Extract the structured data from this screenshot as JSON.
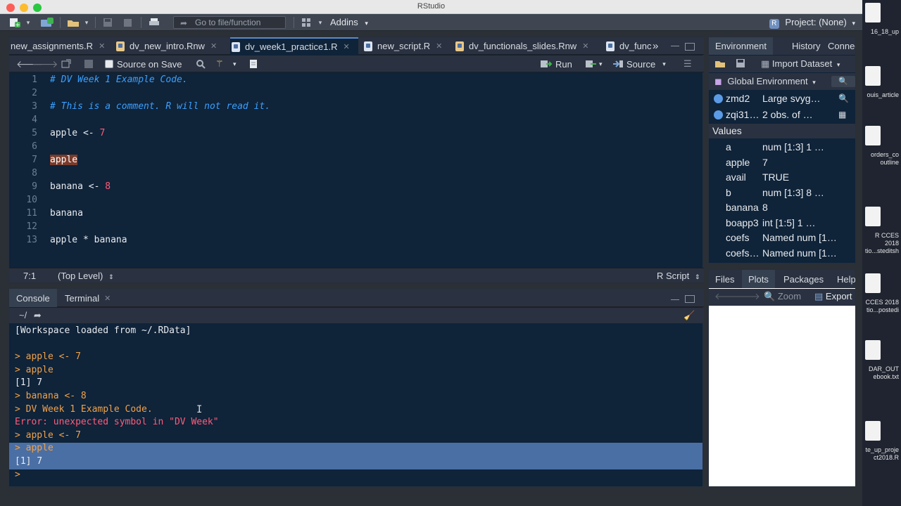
{
  "window": {
    "title": "RStudio"
  },
  "toolbar": {
    "goto_placeholder": "Go to file/function",
    "addins_label": "Addins",
    "project_label": "Project: (None)",
    "project_badge": "R"
  },
  "editor": {
    "tabs": [
      {
        "label": "new_assignments.R",
        "active": false
      },
      {
        "label": "dv_new_intro.Rnw",
        "active": false
      },
      {
        "label": "dv_week1_practice1.R",
        "active": true
      },
      {
        "label": "new_script.R",
        "active": false
      },
      {
        "label": "dv_functionals_slides.Rnw",
        "active": false
      },
      {
        "label": "dv_func",
        "active": false
      }
    ],
    "more_tabs": "»",
    "source_on_save": "Source on Save",
    "run_label": "Run",
    "source_label": "Source",
    "lines": [
      {
        "n": "1",
        "kind": "comment",
        "text": "# DV Week 1 Example Code."
      },
      {
        "n": "2",
        "kind": "blank",
        "text": ""
      },
      {
        "n": "3",
        "kind": "comment",
        "text": "# This is a comment. R will not read it."
      },
      {
        "n": "4",
        "kind": "blank",
        "text": ""
      },
      {
        "n": "5",
        "kind": "assign",
        "text": "apple <- ",
        "num": "7"
      },
      {
        "n": "6",
        "kind": "blank",
        "text": ""
      },
      {
        "n": "7",
        "kind": "highlight",
        "text": "apple"
      },
      {
        "n": "8",
        "kind": "blank",
        "text": ""
      },
      {
        "n": "9",
        "kind": "assign",
        "text": "banana <- ",
        "num": "8"
      },
      {
        "n": "10",
        "kind": "blank",
        "text": ""
      },
      {
        "n": "11",
        "kind": "plain",
        "text": "banana"
      },
      {
        "n": "12",
        "kind": "blank",
        "text": ""
      },
      {
        "n": "13",
        "kind": "plain",
        "text": "apple * banana"
      }
    ],
    "status": {
      "position": "7:1",
      "scope": "(Top Level)",
      "filetype": "R Script"
    }
  },
  "console": {
    "tabs": [
      "Console",
      "Terminal"
    ],
    "path": "~/",
    "lines": [
      {
        "kind": "out",
        "text": "[Workspace loaded from ~/.RData]"
      },
      {
        "kind": "out",
        "text": ""
      },
      {
        "kind": "cmd",
        "text": "> apple <- 7"
      },
      {
        "kind": "cmd",
        "text": "> apple"
      },
      {
        "kind": "out",
        "text": "[1] 7"
      },
      {
        "kind": "cmd",
        "text": "> banana <- 8"
      },
      {
        "kind": "cmd",
        "text": "> DV Week 1 Example Code."
      },
      {
        "kind": "err",
        "text": "Error: unexpected symbol in \"DV Week\""
      },
      {
        "kind": "cmd",
        "text": "> apple <- 7"
      },
      {
        "kind": "cmd-sel",
        "text": "> apple"
      },
      {
        "kind": "out-sel",
        "text": "[1] 7"
      },
      {
        "kind": "cmd",
        "text": "> "
      }
    ]
  },
  "environment": {
    "tabs": [
      "Environment",
      "History",
      "Connections"
    ],
    "import_label": "Import Dataset",
    "scope_label": "Global Environment",
    "data_rows": [
      {
        "name": "zmd2",
        "value": "Large svyg…"
      },
      {
        "name": "zqi31…",
        "value": "2 obs. of …"
      }
    ],
    "values_header": "Values",
    "value_rows": [
      {
        "name": "a",
        "value": "num [1:3] 1 …"
      },
      {
        "name": "apple",
        "value": "7"
      },
      {
        "name": "avail",
        "value": "TRUE"
      },
      {
        "name": "b",
        "value": "num [1:3] 8 …"
      },
      {
        "name": "banana",
        "value": "8"
      },
      {
        "name": "boapp3",
        "value": "int [1:5] 1 …"
      },
      {
        "name": "coefs",
        "value": "Named num [1…"
      },
      {
        "name": "coefs…",
        "value": "Named num [1…"
      }
    ]
  },
  "files": {
    "tabs": [
      "Files",
      "Plots",
      "Packages",
      "Help"
    ],
    "zoom_label": "Zoom",
    "export_label": "Export"
  },
  "desktop": {
    "items": [
      {
        "label": "16_18_up"
      },
      {
        "label": "ouis_article"
      },
      {
        "label": "orders_co outline"
      },
      {
        "label": "R CCES 2018 tio...steditsh"
      },
      {
        "label": "CCES 2018 tio...postedi"
      },
      {
        "label": "DAR_OUT ebook.txt"
      },
      {
        "label": "te_up_proje ct2018.R"
      }
    ]
  }
}
